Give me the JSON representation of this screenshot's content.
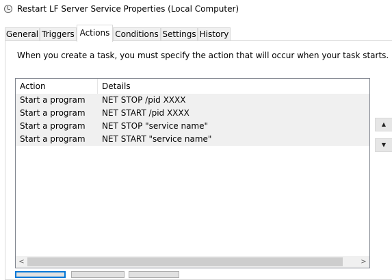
{
  "window": {
    "title": "Restart LF Server Service Properties (Local Computer)",
    "icon": "clock-icon"
  },
  "tabs": [
    {
      "label": "General"
    },
    {
      "label": "Triggers"
    },
    {
      "label": "Actions",
      "active": true
    },
    {
      "label": "Conditions"
    },
    {
      "label": "Settings"
    },
    {
      "label": "History"
    }
  ],
  "description": "When you create a task, you must specify the action that will occur when your task starts.",
  "table": {
    "columns": [
      "Action",
      "Details"
    ],
    "rows": [
      {
        "action": "Start a program",
        "details": "NET STOP /pid XXXX"
      },
      {
        "action": "Start a program",
        "details": "NET START /pid XXXX"
      },
      {
        "action": "Start a program",
        "details": "NET STOP \"service name\""
      },
      {
        "action": "Start a program",
        "details": "NET START \"service name\""
      }
    ]
  },
  "scroll": {
    "left_icon": "scroll-left-icon",
    "left_glyph": "<",
    "right_icon": "scroll-right-icon",
    "right_glyph": ">"
  },
  "move_buttons": {
    "up_icon": "move-up-icon",
    "up_glyph": "▲",
    "down_icon": "move-down-icon",
    "down_glyph": "▼"
  }
}
